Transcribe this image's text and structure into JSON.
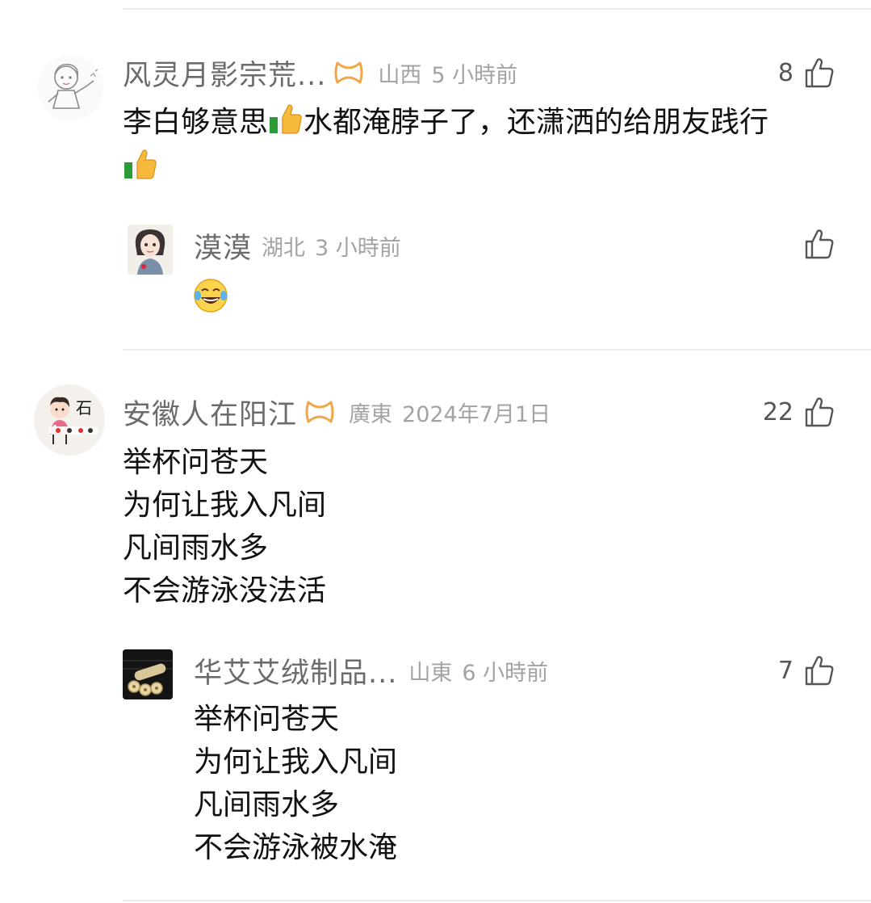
{
  "comments": [
    {
      "username": "风灵月影宗荒...",
      "has_badge": true,
      "region": "山西",
      "time": "5 小時前",
      "likes": "8",
      "text_parts": [
        "李白够意思",
        "水都淹脖子了，还潇洒的给朋友践行"
      ],
      "avatar_desc": "sketch-girl-avatar",
      "reply": {
        "username": "漠漠",
        "region": "湖北",
        "time": "3 小時前",
        "likes": "",
        "emoji": "laughing-crying-emoji"
      }
    },
    {
      "username": "安徽人在阳江",
      "has_badge": true,
      "region": "廣東",
      "time": "2024年7月1日",
      "likes": "22",
      "lines": [
        "举杯问苍天",
        "为何让我入凡间",
        "凡间雨水多",
        "不会游泳没法活"
      ],
      "reply": {
        "username": "华艾艾绒制品...",
        "region": "山東",
        "time": "6 小時前",
        "likes": "7",
        "lines": [
          "举杯问苍天",
          "为何让我入凡间",
          "凡间雨水多",
          "不会游泳被水淹"
        ]
      }
    }
  ],
  "icons": {
    "like": "thumbs-up-outline-icon",
    "badge": "gold-infinity-badge-icon",
    "inline_emoji": "thumbs-up-emoji"
  },
  "colors": {
    "username": "#6b6b6b",
    "meta": "#a3a3a3",
    "badge": "#f0a64a",
    "divider": "#ececec"
  }
}
